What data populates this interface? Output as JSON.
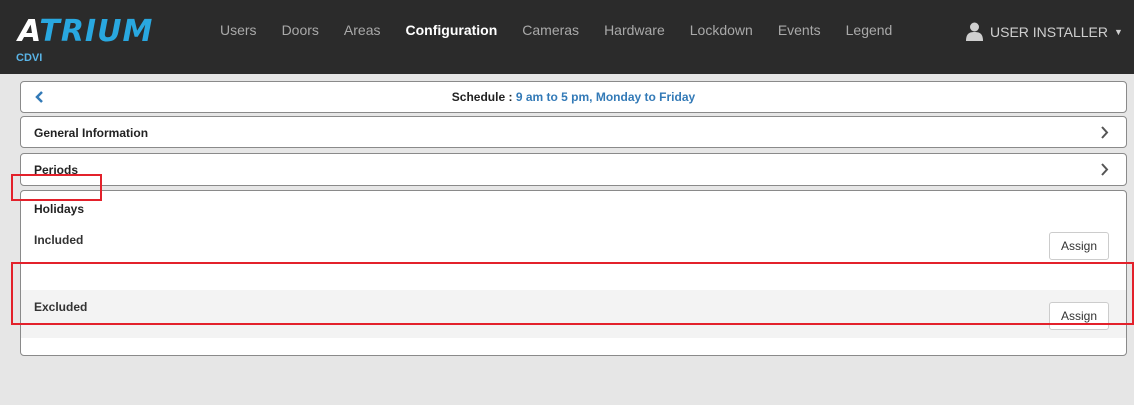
{
  "brand": {
    "name_first": "A",
    "name_rest": "TRIUM",
    "sub": "CDVI"
  },
  "nav": {
    "items": [
      {
        "label": "Users",
        "active": false
      },
      {
        "label": "Doors",
        "active": false
      },
      {
        "label": "Areas",
        "active": false
      },
      {
        "label": "Configuration",
        "active": true
      },
      {
        "label": "Cameras",
        "active": false
      },
      {
        "label": "Hardware",
        "active": false
      },
      {
        "label": "Lockdown",
        "active": false
      },
      {
        "label": "Events",
        "active": false
      },
      {
        "label": "Legend",
        "active": false
      }
    ],
    "user": "USER INSTALLER"
  },
  "schedule": {
    "label": "Schedule :",
    "name": "9 am to 5 pm, Monday to Friday"
  },
  "sections": {
    "general": "General Information",
    "periods": "Periods",
    "holidays": {
      "title": "Holidays",
      "included": "Included",
      "excluded": "Excluded",
      "assign_label": "Assign"
    }
  },
  "colors": {
    "navbar_bg": "#2b2b2b",
    "brand_accent": "#29a8e0",
    "link_blue": "#337ab7",
    "highlight_red": "#e3212b"
  }
}
